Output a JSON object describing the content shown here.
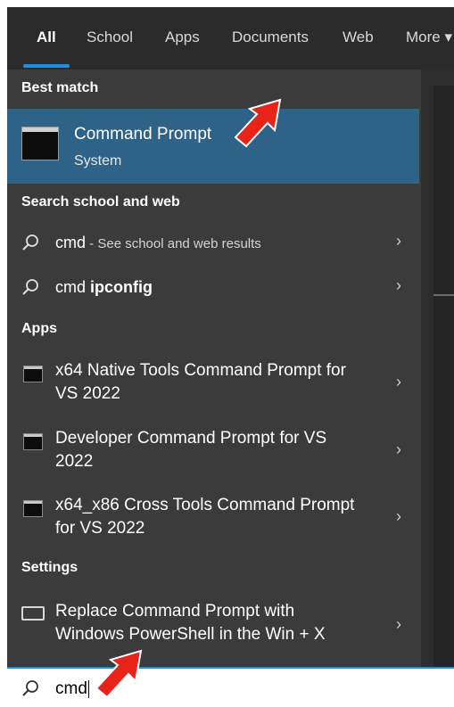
{
  "tabs": [
    {
      "label": "All",
      "active": true
    },
    {
      "label": "School"
    },
    {
      "label": "Apps"
    },
    {
      "label": "Documents"
    },
    {
      "label": "Web"
    },
    {
      "label": "More ▾"
    }
  ],
  "sections": {
    "best_match": "Best match",
    "search_school_web": "Search school and web",
    "apps": "Apps",
    "settings": "Settings"
  },
  "best_match": {
    "title": "Command Prompt",
    "subtitle": "System"
  },
  "web_results": [
    {
      "query": "cmd",
      "suffix": " - See school and web results"
    },
    {
      "query_prefix": "cmd ",
      "query_bold": "ipconfig"
    }
  ],
  "apps": [
    {
      "label": "x64 Native Tools Command Prompt for VS 2022"
    },
    {
      "label": "Developer Command Prompt for VS 2022"
    },
    {
      "label": "x64_x86 Cross Tools Command Prompt for VS 2022"
    }
  ],
  "settings_items": [
    {
      "label": "Replace Command Prompt with Windows PowerShell in the Win + X"
    }
  ],
  "search": {
    "value": "cmd"
  },
  "icons": {
    "chevron": "›",
    "search": "search-icon",
    "app": "console-app-icon",
    "settings": "settings-display-icon"
  },
  "colors": {
    "accent": "#1e8fe0",
    "highlight": "#2f6287",
    "annotation": "#e8231a"
  }
}
